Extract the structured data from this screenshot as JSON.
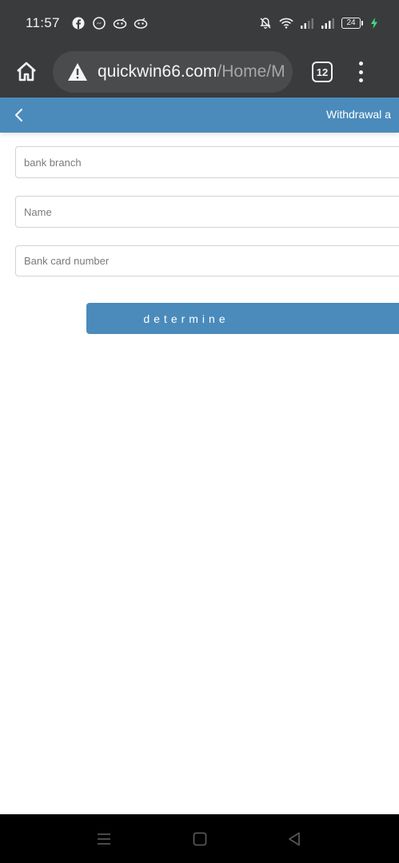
{
  "status_bar": {
    "time": "11:57",
    "battery_level": "24",
    "icons": [
      "facebook-icon",
      "messenger-icon",
      "app-notification-icon",
      "app-notification-icon",
      "mute-icon",
      "wifi-icon",
      "signal-icon",
      "signal-icon",
      "battery-icon",
      "charging-icon"
    ]
  },
  "browser": {
    "url_domain": "quickwin66.com",
    "url_path": "/Home/M",
    "tab_count": "12"
  },
  "header": {
    "title": "Withdrawal a"
  },
  "form": {
    "bank_branch_placeholder": "bank branch",
    "name_placeholder": "Name",
    "card_number_placeholder": "Bank card number",
    "submit_label": "determine"
  },
  "colors": {
    "header_blue": "#4a8bbb",
    "browser_dark": "#3a3b3d"
  }
}
